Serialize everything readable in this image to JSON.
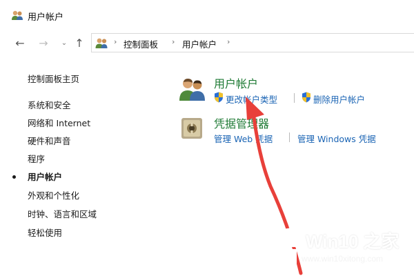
{
  "window": {
    "title": "用户帐户"
  },
  "nav": {
    "breadcrumb": [
      "控制面板",
      "用户帐户"
    ]
  },
  "sidebar": {
    "home": "控制面板主页",
    "items": [
      {
        "label": "系统和安全",
        "active": false
      },
      {
        "label": "网络和 Internet",
        "active": false
      },
      {
        "label": "硬件和声音",
        "active": false
      },
      {
        "label": "程序",
        "active": false
      },
      {
        "label": "用户帐户",
        "active": true
      },
      {
        "label": "外观和个性化",
        "active": false
      },
      {
        "label": "时钟、语言和区域",
        "active": false
      },
      {
        "label": "轻松使用",
        "active": false
      }
    ]
  },
  "main": {
    "user_accounts": {
      "title": "用户帐户",
      "links": [
        "更改帐户类型",
        "删除用户帐户"
      ]
    },
    "credential_manager": {
      "title": "凭据管理器",
      "links": [
        "管理 Web 凭据",
        "管理 Windows 凭据"
      ]
    }
  },
  "watermark": {
    "title": "Win10 之家",
    "url": "www.win10xitong.com"
  },
  "colors": {
    "category_title": "#1e7a34",
    "link": "#1a64b4",
    "arrow": "#e8403a",
    "watermark_bg": "#d6342c",
    "win_logo": "#1e8fe0"
  }
}
